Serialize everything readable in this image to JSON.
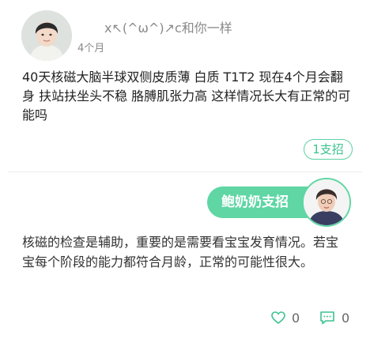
{
  "post": {
    "username": "x↖(^ω^)↗c和你一样",
    "time": "4个月",
    "question": "40天核磁大脑半球双侧皮质薄 白质 T1T2 现在4个月会翻身 扶站扶坐头不稳 胳膊肌张力高 这样情况长大有正常的可能吗",
    "support_label": "1支招"
  },
  "answer": {
    "expert_label": "鲍奶奶支招",
    "text": "核磁的检查是辅助，重要的是需要看宝宝发育情况。若宝宝每个阶段的能力都符合月龄，正常的可能性很大。",
    "like_count": "0",
    "comment_count": "0"
  },
  "colors": {
    "accent": "#5fd6a4",
    "muted_text": "#8a8a8a"
  },
  "icons": {
    "like": "heart-outline-icon",
    "comment": "speech-bubble-icon"
  }
}
